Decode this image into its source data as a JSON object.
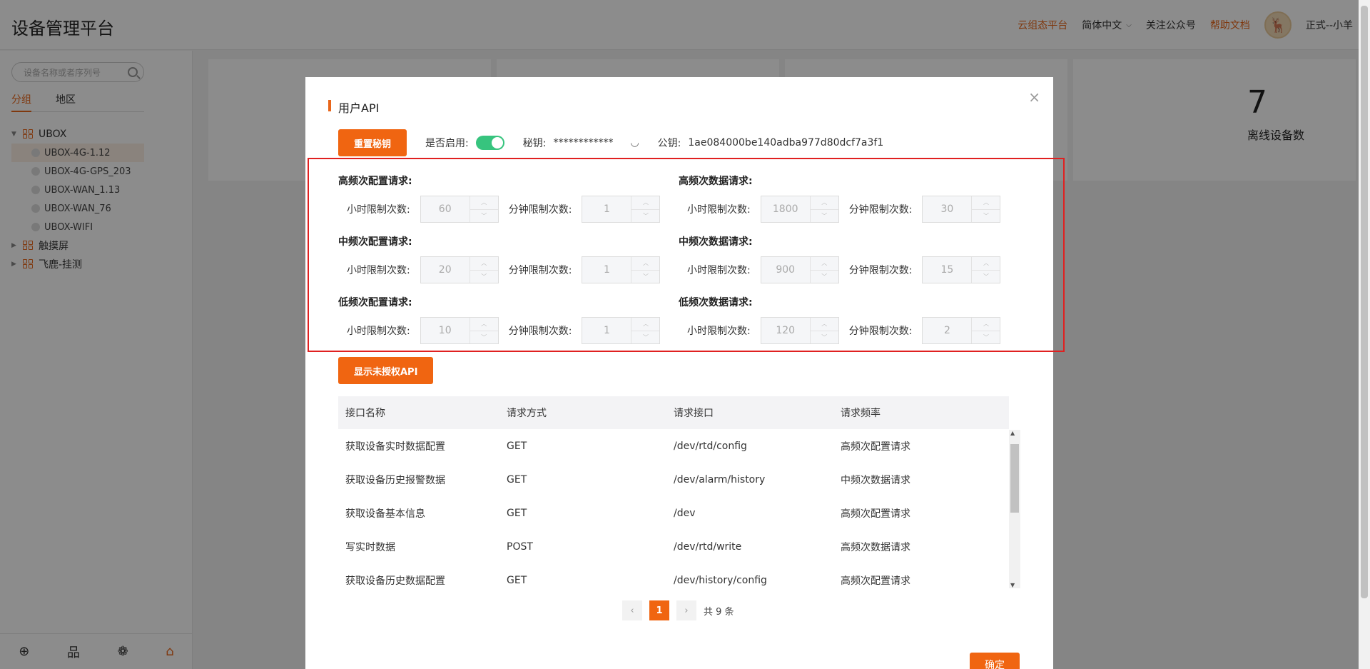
{
  "header": {
    "title": "设备管理平台",
    "links": {
      "cloud": "云组态平台",
      "lang": "简体中文",
      "follow": "关注公众号",
      "help": "帮助文档"
    },
    "user": "正式--小羊"
  },
  "sidebar": {
    "search_placeholder": "设备名称或者序列号",
    "tabs": [
      "分组",
      "地区"
    ],
    "tree": {
      "group1": "UBOX",
      "devices": [
        "UBOX-4G-1.12",
        "UBOX-4G-GPS_203",
        "UBOX-WAN_1.13",
        "UBOX-WAN_76",
        "UBOX-WIFI"
      ],
      "group2": "触摸屏",
      "group3": "飞鹿-挂测"
    }
  },
  "main": {
    "offline_count": "7",
    "offline_label": "离线设备数"
  },
  "modal": {
    "title": "用户API",
    "reset_button": "重置秘钥",
    "enable_label": "是否启用:",
    "secret_label": "秘钥:",
    "secret_value": "************",
    "public_label": "公钥:",
    "public_value": "1ae084000be140adba977d80dcf7a3f1",
    "limits": {
      "hour_label": "小时限制次数:",
      "minute_label": "分钟限制次数:",
      "high_config": {
        "title": "高频次配置请求:",
        "hour": "60",
        "minute": "1"
      },
      "high_data": {
        "title": "高频次数据请求:",
        "hour": "1800",
        "minute": "30"
      },
      "mid_config": {
        "title": "中频次配置请求:",
        "hour": "20",
        "minute": "1"
      },
      "mid_data": {
        "title": "中频次数据请求:",
        "hour": "900",
        "minute": "15"
      },
      "low_config": {
        "title": "低频次配置请求:",
        "hour": "10",
        "minute": "1"
      },
      "low_data": {
        "title": "低频次数据请求:",
        "hour": "120",
        "minute": "2"
      }
    },
    "show_unauth_button": "显示未授权API",
    "table": {
      "headers": [
        "接口名称",
        "请求方式",
        "请求接口",
        "请求频率"
      ],
      "rows": [
        [
          "获取设备实时数据配置",
          "GET",
          "/dev/rtd/config",
          "高频次配置请求"
        ],
        [
          "获取设备历史报警数据",
          "GET",
          "/dev/alarm/history",
          "中频次数据请求"
        ],
        [
          "获取设备基本信息",
          "GET",
          "/dev",
          "高频次配置请求"
        ],
        [
          "写实时数据",
          "POST",
          "/dev/rtd/write",
          "高频次数据请求"
        ],
        [
          "获取设备历史数据配置",
          "GET",
          "/dev/history/config",
          "高频次配置请求"
        ]
      ]
    },
    "pagination": {
      "page": "1",
      "total": "共 9 条"
    },
    "confirm_button": "确定"
  }
}
